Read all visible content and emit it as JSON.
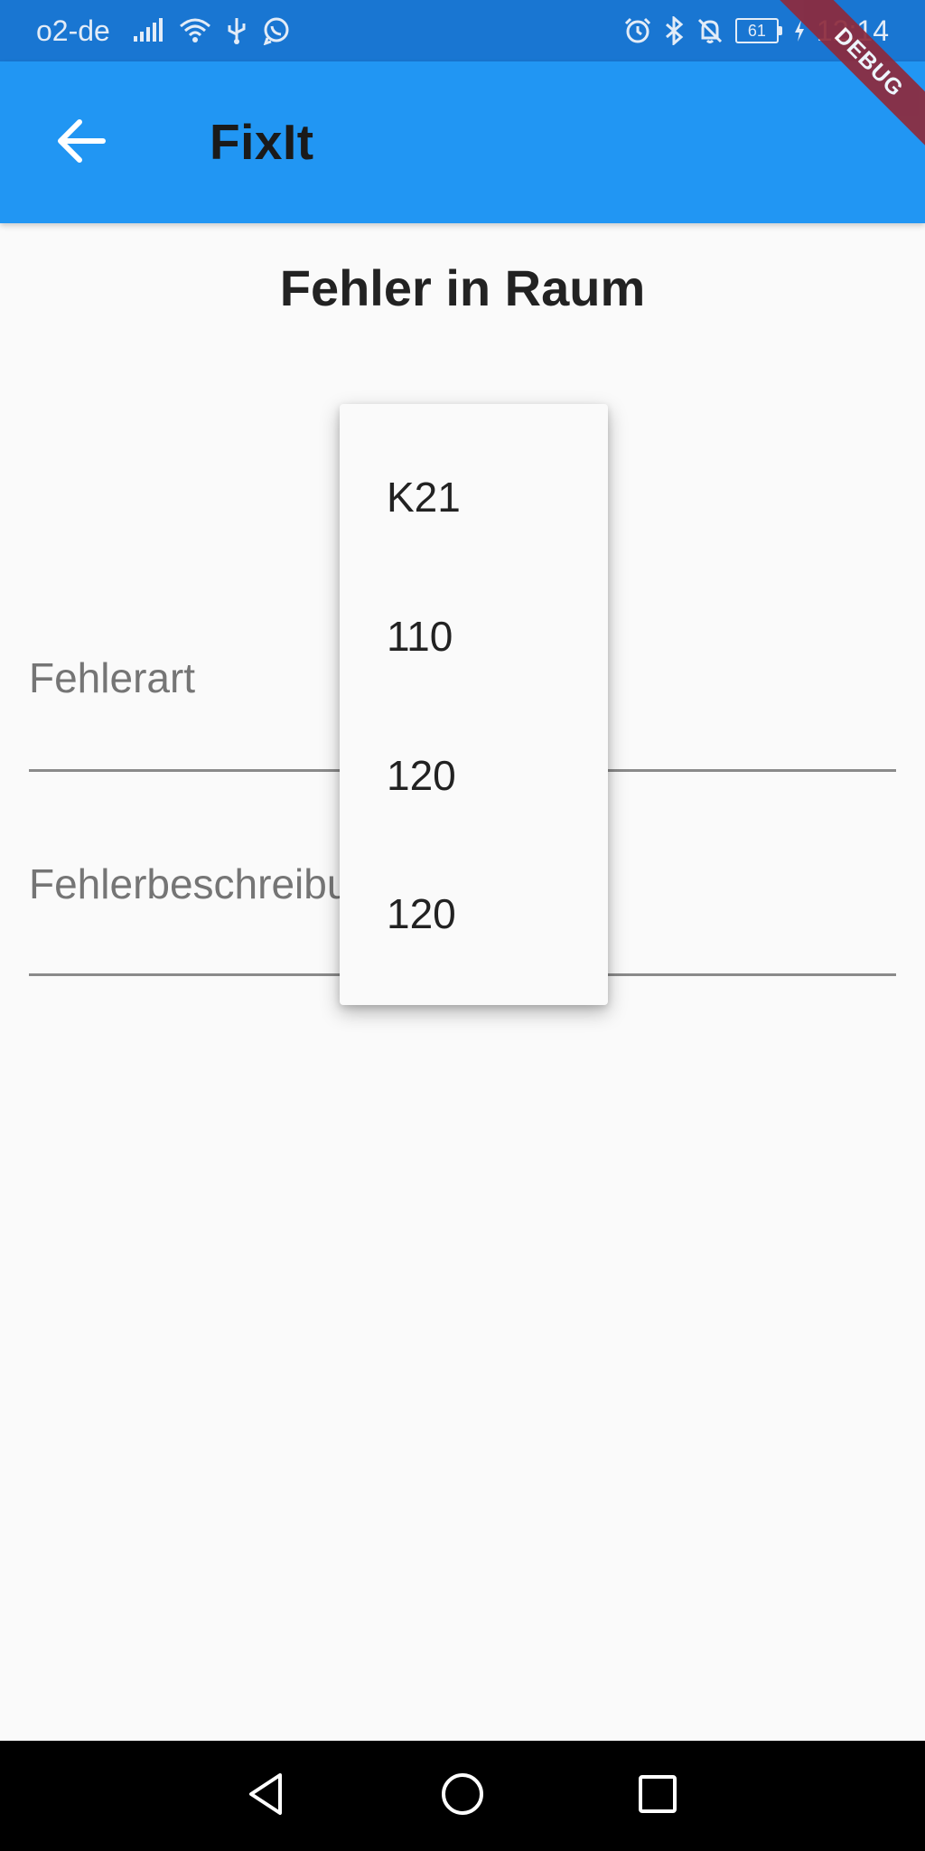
{
  "status_bar": {
    "carrier": "o2-de",
    "battery_level": "61",
    "time": "12:14",
    "icons": [
      "signal-icon",
      "wifi-icon",
      "usb-icon",
      "whatsapp-icon",
      "alarm-icon",
      "bluetooth-icon",
      "notifications-off-icon",
      "battery-icon",
      "charging-icon"
    ]
  },
  "app_bar": {
    "title": "FixIt",
    "back_icon": "arrow-back-icon"
  },
  "debug_banner": "DEBUG",
  "main": {
    "heading": "Fehler in Raum",
    "fields": [
      {
        "label": "Fehlerart",
        "value": ""
      },
      {
        "label": "Fehlerbeschreibung",
        "value": ""
      }
    ]
  },
  "dropdown": {
    "items": [
      "K21",
      "110",
      "120",
      "120"
    ]
  },
  "nav_bar": {
    "buttons": [
      "back-triangle-icon",
      "home-circle-icon",
      "recents-square-icon"
    ]
  },
  "colors": {
    "status_bar": "#1976d2",
    "app_bar": "#2196f3",
    "background": "#fafafa",
    "debug_ribbon": "#8e2a3c",
    "nav_bar": "#000000"
  }
}
